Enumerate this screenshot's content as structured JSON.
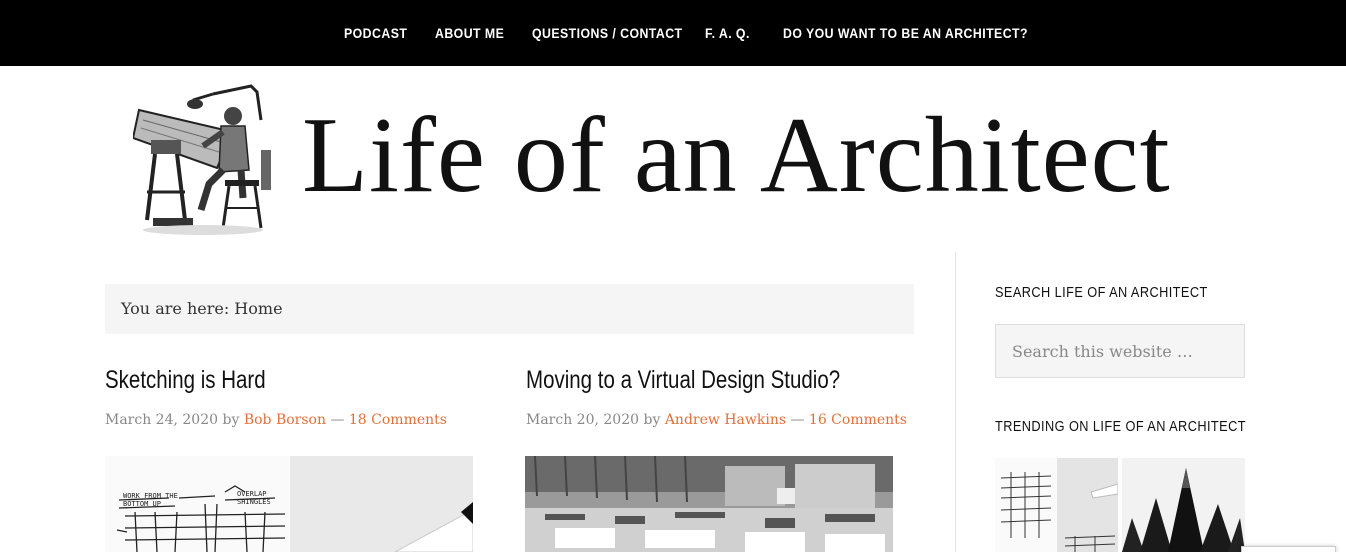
{
  "nav": {
    "items": [
      {
        "label": "PODCAST"
      },
      {
        "label": "ABOUT ME"
      },
      {
        "label": "QUESTIONS / CONTACT"
      },
      {
        "label": "F. A. Q."
      },
      {
        "label": "DO YOU WANT TO BE AN ARCHITECT?"
      }
    ]
  },
  "header": {
    "site_title": "Life of an Architect",
    "logo_icon": "architect-drafting-table-illustration"
  },
  "breadcrumb": {
    "text": "You are here: Home"
  },
  "posts": [
    {
      "title": "Sketching is Hard",
      "date": "March 24, 2020",
      "by": "by",
      "author": "Bob Borson",
      "sep": "—",
      "comments": "18 Comments"
    },
    {
      "title": "Moving to a Virtual Design Studio?",
      "date": "March 20, 2020",
      "by": "by",
      "author": "Andrew Hawkins",
      "sep": "—",
      "comments": "16 Comments"
    }
  ],
  "sidebar": {
    "search_title": "SEARCH LIFE OF AN ARCHITECT",
    "search_placeholder": "Search this website …",
    "trending_title": "TRENDING ON LIFE OF AN ARCHITECT"
  },
  "colors": {
    "link": "#e0703a",
    "nav_bg": "#000000"
  }
}
